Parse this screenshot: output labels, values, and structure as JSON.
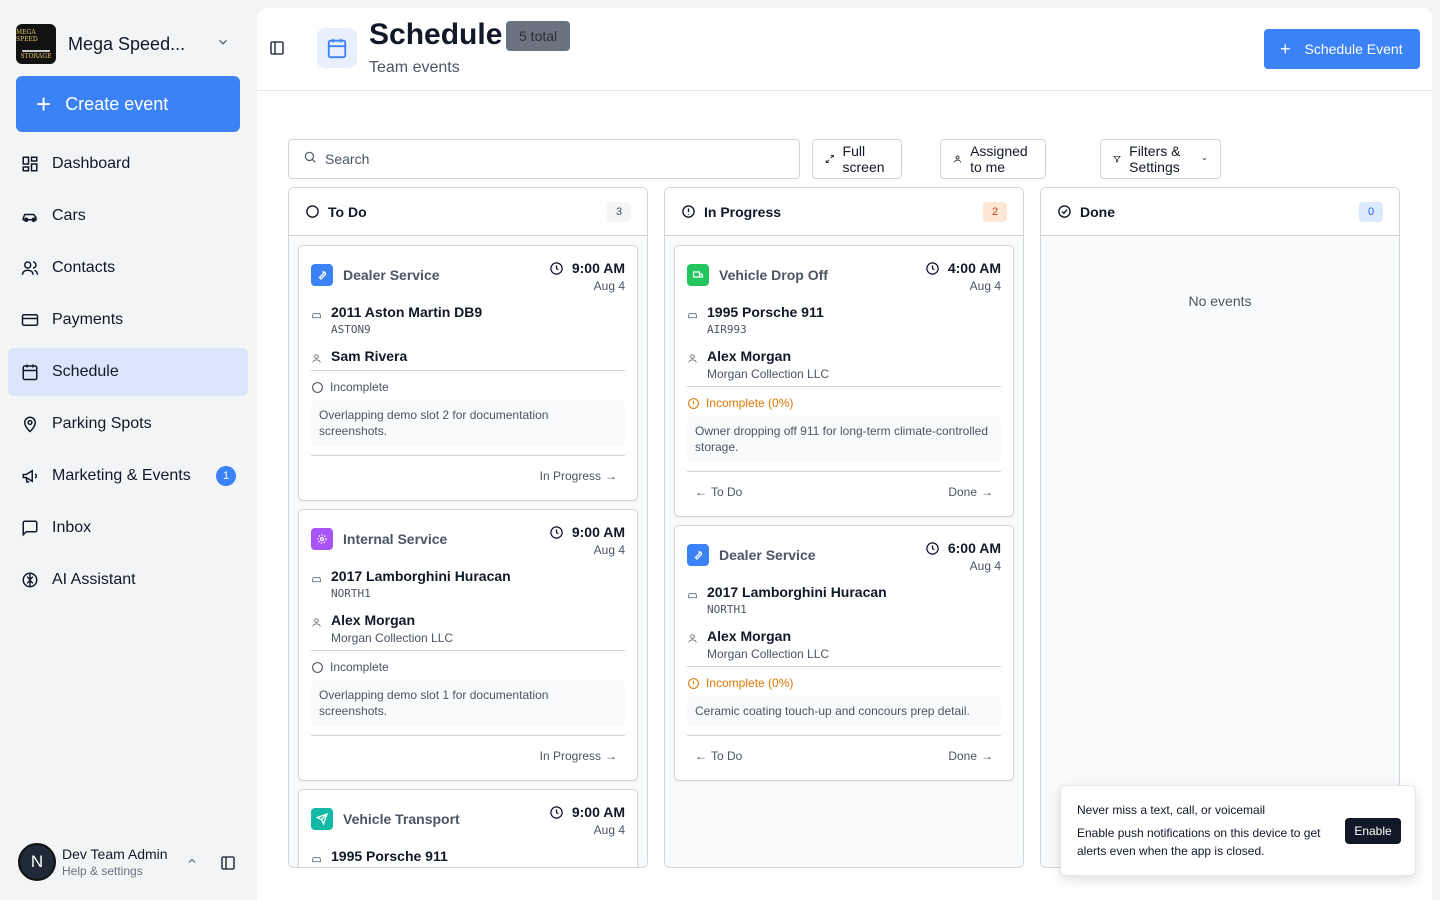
{
  "brand": {
    "name": "Mega Speed...",
    "logo_top": "MEGA SPEED",
    "logo_bottom": "STORAGE"
  },
  "create_label": "Create event",
  "nav": [
    {
      "label": "Dashboard",
      "icon": "dashboard-icon"
    },
    {
      "label": "Cars",
      "icon": "car-icon"
    },
    {
      "label": "Contacts",
      "icon": "users-icon"
    },
    {
      "label": "Payments",
      "icon": "credit-card-icon"
    },
    {
      "label": "Schedule",
      "icon": "calendar-icon",
      "active": true
    },
    {
      "label": "Parking Spots",
      "icon": "map-pin-icon"
    },
    {
      "label": "Marketing & Events",
      "icon": "megaphone-icon",
      "badge": "1"
    },
    {
      "label": "Inbox",
      "icon": "message-square-icon"
    },
    {
      "label": "AI Assistant",
      "icon": "brain-icon"
    }
  ],
  "user": {
    "initial": "N",
    "name": "Dev Team Admin",
    "sub": "Help & settings"
  },
  "header": {
    "title": "Schedule",
    "badge": "5 total",
    "subtitle": "Team events",
    "button": "Schedule Event"
  },
  "toolbar": {
    "search_placeholder": "Search",
    "fullscreen": "Full screen",
    "assigned": "Assigned to me",
    "filters": "Filters & Settings"
  },
  "columns": [
    {
      "title": "To Do",
      "count": "3"
    },
    {
      "title": "In Progress",
      "count": "2"
    },
    {
      "title": "Done",
      "count": "0",
      "empty": "No events"
    }
  ],
  "todo_cards": [
    {
      "type": "Dealer Service",
      "time": "9:00 AM",
      "date": "Aug 4",
      "car": "2011 Aston Martin DB9",
      "plate": "ASTON9",
      "person": "Sam Rivera",
      "status": "Incomplete",
      "note": "Overlapping demo slot 2 for documentation screenshots.",
      "next": "In Progress"
    },
    {
      "type": "Internal Service",
      "time": "9:00 AM",
      "date": "Aug 4",
      "car": "2017 Lamborghini Huracan",
      "plate": "NORTH1",
      "person": "Alex Morgan",
      "company": "Morgan Collection LLC",
      "status": "Incomplete",
      "note": "Overlapping demo slot 1 for documentation screenshots.",
      "next": "In Progress"
    },
    {
      "type": "Vehicle Transport",
      "time": "9:00 AM",
      "date": "Aug 4",
      "car": "1995 Porsche 911"
    }
  ],
  "progress_cards": [
    {
      "type": "Vehicle Drop Off",
      "time": "4:00 AM",
      "date": "Aug 4",
      "car": "1995 Porsche 911",
      "plate": "AIR993",
      "person": "Alex Morgan",
      "company": "Morgan Collection LLC",
      "status": "Incomplete (0%)",
      "note": "Owner dropping off 911 for long-term climate-controlled storage.",
      "prev": "To Do",
      "next": "Done"
    },
    {
      "type": "Dealer Service",
      "time": "6:00 AM",
      "date": "Aug 4",
      "car": "2017 Lamborghini Huracan",
      "plate": "NORTH1",
      "person": "Alex Morgan",
      "company": "Morgan Collection LLC",
      "status": "Incomplete (0%)",
      "note": "Ceramic coating touch-up and concours prep detail.",
      "prev": "To Do",
      "next": "Done"
    }
  ],
  "toast": {
    "title": "Never miss a text, call, or voicemail",
    "body": "Enable push notifications on this device to get alerts even when the app is closed.",
    "button": "Enable"
  },
  "colors": {
    "accent": "#3b82f6",
    "active_nav": "#dbe5fb",
    "warning": "#d97706",
    "dealer": "#3b82f6",
    "internal": "#a855f7",
    "dropoff": "#22c55e",
    "transport": "#14b8a6"
  }
}
